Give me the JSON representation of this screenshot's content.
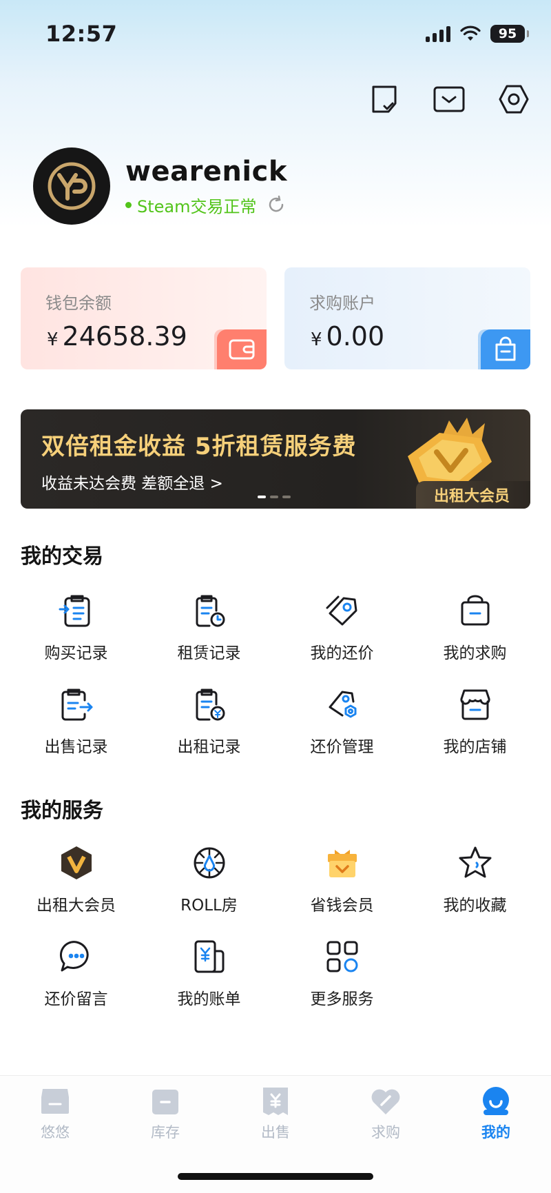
{
  "status_bar": {
    "time": "12:57",
    "battery": "95"
  },
  "profile": {
    "username": "wearenick",
    "steam_status": "Steam交易正常"
  },
  "wallet_card": {
    "label": "钱包余额",
    "currency": "¥",
    "amount": "24658.39"
  },
  "buy_card": {
    "label": "求购账户",
    "currency": "¥",
    "amount": "0.00"
  },
  "banner": {
    "title": "双倍租金收益  5折租赁服务费",
    "subtitle": "收益未达会费 差额全退 >",
    "tag": "出租大会员",
    "page_count": 3,
    "active_page": 1
  },
  "my_trades": {
    "title": "我的交易",
    "items": [
      {
        "label": "购买记录",
        "icon": "purchase-record-icon"
      },
      {
        "label": "租赁记录",
        "icon": "lease-record-icon"
      },
      {
        "label": "我的还价",
        "icon": "my-counteroffer-icon"
      },
      {
        "label": "我的求购",
        "icon": "my-buy-request-icon"
      },
      {
        "label": "出售记录",
        "icon": "sale-record-icon"
      },
      {
        "label": "出租记录",
        "icon": "rent-out-record-icon"
      },
      {
        "label": "还价管理",
        "icon": "counteroffer-manage-icon"
      },
      {
        "label": "我的店铺",
        "icon": "my-shop-icon"
      }
    ]
  },
  "my_services": {
    "title": "我的服务",
    "items": [
      {
        "label": "出租大会员",
        "icon": "vip-badge-icon"
      },
      {
        "label": "ROLL房",
        "icon": "roll-room-icon"
      },
      {
        "label": "省钱会员",
        "icon": "gift-box-icon"
      },
      {
        "label": "我的收藏",
        "icon": "star-icon"
      },
      {
        "label": "还价留言",
        "icon": "chat-bubble-icon"
      },
      {
        "label": "我的账单",
        "icon": "bill-icon"
      },
      {
        "label": "更多服务",
        "icon": "more-grid-icon"
      }
    ]
  },
  "tabbar": {
    "items": [
      {
        "label": "悠悠",
        "icon": "shop-icon"
      },
      {
        "label": "库存",
        "icon": "inventory-icon"
      },
      {
        "label": "出售",
        "icon": "sell-icon"
      },
      {
        "label": "求购",
        "icon": "buy-request-icon"
      },
      {
        "label": "我的",
        "icon": "profile-icon"
      }
    ],
    "active_index": 4
  },
  "colors": {
    "accent": "#1a84f0",
    "steam_ok": "#52c41a",
    "banner_gold": "#f6d07a",
    "wallet": "#ff7f6e",
    "buy": "#3d98f2"
  }
}
